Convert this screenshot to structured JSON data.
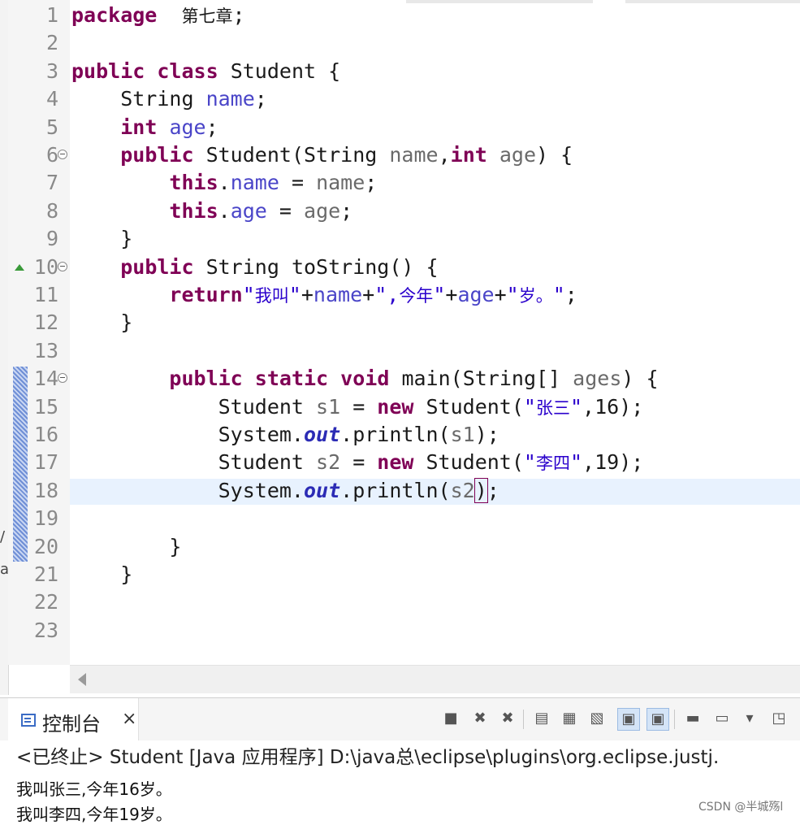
{
  "editor": {
    "lines": [
      {
        "n": "1",
        "parts": [
          [
            "kw",
            "package"
          ],
          [
            "",
            "  "
          ],
          [
            "cjk",
            "第七章"
          ],
          [
            "",
            ";"
          ]
        ]
      },
      {
        "n": "2",
        "parts": []
      },
      {
        "n": "3",
        "parts": [
          [
            "kw",
            "public"
          ],
          [
            "",
            " "
          ],
          [
            "kw",
            "class"
          ],
          [
            "",
            " Student {"
          ]
        ]
      },
      {
        "n": "4",
        "parts": [
          [
            "",
            "    String "
          ],
          [
            "fld",
            "name"
          ],
          [
            "",
            ";"
          ]
        ]
      },
      {
        "n": "5",
        "parts": [
          [
            "",
            "    "
          ],
          [
            "kw",
            "int"
          ],
          [
            "",
            " "
          ],
          [
            "fld",
            "age"
          ],
          [
            "",
            ";"
          ]
        ]
      },
      {
        "n": "6",
        "fold": true,
        "parts": [
          [
            "",
            "    "
          ],
          [
            "kw",
            "public"
          ],
          [
            "",
            " Student(String "
          ],
          [
            "var",
            "name"
          ],
          [
            "",
            ","
          ],
          [
            "kw",
            "int"
          ],
          [
            "",
            " "
          ],
          [
            "var",
            "age"
          ],
          [
            "",
            ") {"
          ]
        ]
      },
      {
        "n": "7",
        "parts": [
          [
            "",
            "        "
          ],
          [
            "kw",
            "this"
          ],
          [
            "",
            "."
          ],
          [
            "fld",
            "name"
          ],
          [
            "",
            " = "
          ],
          [
            "var",
            "name"
          ],
          [
            "",
            ";"
          ]
        ]
      },
      {
        "n": "8",
        "parts": [
          [
            "",
            "        "
          ],
          [
            "kw",
            "this"
          ],
          [
            "",
            "."
          ],
          [
            "fld",
            "age"
          ],
          [
            "",
            " = "
          ],
          [
            "var",
            "age"
          ],
          [
            "",
            ";"
          ]
        ]
      },
      {
        "n": "9",
        "parts": [
          [
            "",
            "    }"
          ]
        ]
      },
      {
        "n": "10",
        "fold": true,
        "override": true,
        "parts": [
          [
            "",
            "    "
          ],
          [
            "kw",
            "public"
          ],
          [
            "",
            " String toString() {"
          ]
        ]
      },
      {
        "n": "11",
        "parts": [
          [
            "",
            "        "
          ],
          [
            "kw",
            "return"
          ],
          [
            "str",
            "\""
          ],
          [
            "str cjk",
            "我叫"
          ],
          [
            "str",
            "\""
          ],
          [
            "",
            "+"
          ],
          [
            "fld",
            "name"
          ],
          [
            "",
            "+"
          ],
          [
            "str",
            "\","
          ],
          [
            "str cjk",
            "今年"
          ],
          [
            "str",
            "\""
          ],
          [
            "",
            "+"
          ],
          [
            "fld",
            "age"
          ],
          [
            "",
            "+"
          ],
          [
            "str",
            "\""
          ],
          [
            "str cjk",
            "岁。"
          ],
          [
            "str",
            "\""
          ],
          [
            "",
            ";"
          ]
        ]
      },
      {
        "n": "12",
        "parts": [
          [
            "",
            "    }"
          ]
        ]
      },
      {
        "n": "13",
        "parts": []
      },
      {
        "n": "14",
        "fold": true,
        "parts": [
          [
            "",
            "        "
          ],
          [
            "kw",
            "public"
          ],
          [
            "",
            " "
          ],
          [
            "kw",
            "static"
          ],
          [
            "",
            " "
          ],
          [
            "kw",
            "void"
          ],
          [
            "",
            " main(String[] "
          ],
          [
            "var",
            "ages"
          ],
          [
            "",
            ") {"
          ]
        ]
      },
      {
        "n": "15",
        "parts": [
          [
            "",
            "            Student "
          ],
          [
            "var",
            "s1"
          ],
          [
            "",
            " = "
          ],
          [
            "kw",
            "new"
          ],
          [
            "",
            " Student("
          ],
          [
            "str",
            "\""
          ],
          [
            "str cjk",
            "张三"
          ],
          [
            "str",
            "\""
          ],
          [
            "",
            ",16);"
          ]
        ]
      },
      {
        "n": "16",
        "parts": [
          [
            "",
            "            System."
          ],
          [
            "sf",
            "out"
          ],
          [
            "",
            ".println("
          ],
          [
            "var",
            "s1"
          ],
          [
            "",
            ");"
          ]
        ]
      },
      {
        "n": "17",
        "parts": [
          [
            "",
            "            Student "
          ],
          [
            "var",
            "s2"
          ],
          [
            "",
            " = "
          ],
          [
            "kw",
            "new"
          ],
          [
            "",
            " Student("
          ],
          [
            "str",
            "\""
          ],
          [
            "str cjk",
            "李四"
          ],
          [
            "str",
            "\""
          ],
          [
            "",
            ",19);"
          ]
        ]
      },
      {
        "n": "18",
        "current": true,
        "parts": [
          [
            "",
            "            System."
          ],
          [
            "sf",
            "out"
          ],
          [
            "",
            ".println("
          ],
          [
            "var",
            "s2"
          ],
          [
            "bracket",
            ")"
          ],
          [
            "",
            ";"
          ]
        ]
      },
      {
        "n": "19",
        "parts": []
      },
      {
        "n": "20",
        "parts": [
          [
            "",
            "        }"
          ]
        ]
      },
      {
        "n": "21",
        "parts": [
          [
            "",
            "    }"
          ]
        ]
      },
      {
        "n": "22",
        "parts": []
      },
      {
        "n": "23",
        "parts": []
      }
    ]
  },
  "console": {
    "tab_label": "控制台",
    "close_glyph": "×",
    "status": "<已终止> Student [Java 应用程序] D:\\java总\\eclipse\\plugins\\org.eclipse.justj.",
    "output": [
      "我叫张三,今年16岁。",
      "我叫李四,今年19岁。"
    ],
    "toolbar": [
      {
        "name": "terminate-icon",
        "glyph": "■"
      },
      {
        "name": "remove-launch-icon",
        "glyph": "✖"
      },
      {
        "name": "remove-all-icon",
        "glyph": "✖"
      },
      {
        "name": "clear-console-icon",
        "glyph": "▤"
      },
      {
        "name": "scroll-lock-icon",
        "glyph": "▦"
      },
      {
        "name": "word-wrap-icon",
        "glyph": "▧"
      },
      {
        "name": "show-stdout-icon",
        "glyph": "▣"
      },
      {
        "name": "show-stderr-icon",
        "glyph": "▣"
      },
      {
        "name": "pin-console-icon",
        "glyph": "▬"
      },
      {
        "name": "display-console-icon",
        "glyph": "▭"
      },
      {
        "name": "dropdown-icon",
        "glyph": "▾"
      },
      {
        "name": "new-console-icon",
        "glyph": "◳"
      }
    ]
  },
  "watermark": "CSDN @半城殇l"
}
